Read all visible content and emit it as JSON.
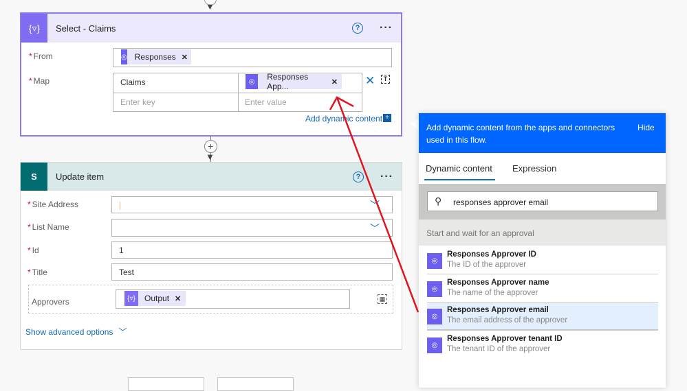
{
  "select_card": {
    "title": "Select - Claims",
    "help_icon": "question-icon",
    "more_icon": "ellipsis-icon",
    "from_label": "From",
    "from_token": "Responses",
    "map_label": "Map",
    "map_key": "Claims",
    "map_value_token": "Responses App...",
    "key_placeholder": "Enter key",
    "value_placeholder": "Enter value",
    "add_dynamic_content": "Add dynamic content",
    "accent_color": "#7e6cf2"
  },
  "update_card": {
    "title": "Update item",
    "fields": [
      {
        "label": "Site Address",
        "value": "",
        "required": true,
        "dropdown": true
      },
      {
        "label": "List Name",
        "value": "",
        "required": true,
        "dropdown": true
      },
      {
        "label": "Id",
        "value": "1",
        "required": true,
        "dropdown": false
      },
      {
        "label": "Title",
        "value": "Test",
        "required": true,
        "dropdown": false
      }
    ],
    "approvers_label": "Approvers",
    "approvers_token": "Output",
    "show_advanced": "Show advanced options",
    "accent_color": "#036c70"
  },
  "dynamic_panel": {
    "header_text": "Add dynamic content from the apps and connectors used in this flow.",
    "hide_label": "Hide",
    "tabs": [
      {
        "label": "Dynamic content",
        "active": true
      },
      {
        "label": "Expression",
        "active": false
      }
    ],
    "search_value": "responses approver email",
    "section_title": "Start and wait for an approval",
    "items": [
      {
        "title": "Responses Approver ID",
        "description": "The ID of the approver"
      },
      {
        "title": "Responses Approver name",
        "description": "The name of the approver"
      },
      {
        "title": "Responses Approver email",
        "description": "The email address of the approver",
        "highlighted": true
      },
      {
        "title": "Responses Approver tenant ID",
        "description": "The tenant ID of the approver"
      }
    ],
    "header_color": "#0066ff"
  }
}
